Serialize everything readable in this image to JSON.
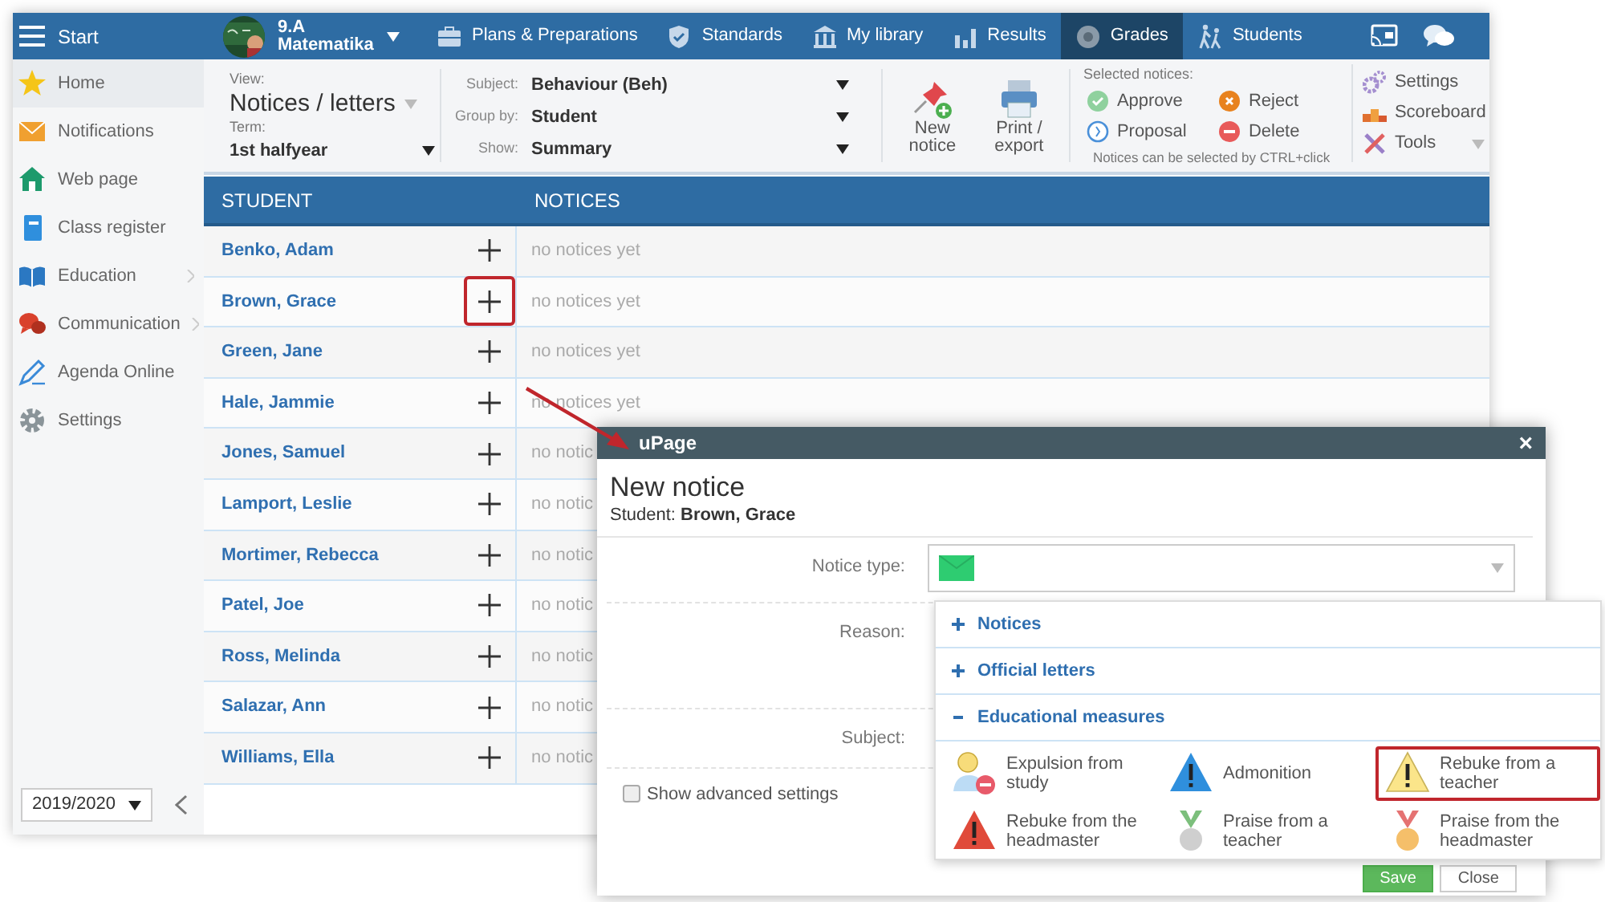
{
  "topbar": {
    "menu_label": "Start",
    "class_name": "9.A",
    "class_subject": "Matematika",
    "nav": [
      {
        "label": "Plans & Preparations",
        "selected": false
      },
      {
        "label": "Standards",
        "selected": false
      },
      {
        "label": "My library",
        "selected": false
      },
      {
        "label": "Results",
        "selected": false
      },
      {
        "label": "Grades",
        "selected": true
      },
      {
        "label": "Students",
        "selected": false
      }
    ]
  },
  "sidebar": {
    "items": [
      {
        "label": "Home",
        "selected": true,
        "has_submenu": false
      },
      {
        "label": "Notifications",
        "selected": false,
        "has_submenu": false
      },
      {
        "label": "Web page",
        "selected": false,
        "has_submenu": false
      },
      {
        "label": "Class register",
        "selected": false,
        "has_submenu": false
      },
      {
        "label": "Education",
        "selected": false,
        "has_submenu": true
      },
      {
        "label": "Communication",
        "selected": false,
        "has_submenu": true
      },
      {
        "label": "Agenda Online",
        "selected": false,
        "has_submenu": false
      },
      {
        "label": "Settings",
        "selected": false,
        "has_submenu": false
      }
    ],
    "year": "2019/2020"
  },
  "toolbar": {
    "view": {
      "label": "View:",
      "value": "Notices / letters"
    },
    "term": {
      "label": "Term:",
      "value": "1st halfyear"
    },
    "filters": [
      {
        "label": "Subject:",
        "value": "Behaviour (Beh)"
      },
      {
        "label": "Group by:",
        "value": "Student"
      },
      {
        "label": "Show:",
        "value": "Summary"
      }
    ],
    "actions": [
      "New notice",
      "Print / export"
    ],
    "selected_notices": {
      "title": "Selected notices:",
      "buttons": [
        "Approve",
        "Reject",
        "Proposal",
        "Delete"
      ],
      "hint": "Notices can be selected by CTRL+click"
    },
    "tools": [
      "Settings",
      "Scoreboard",
      "Tools"
    ]
  },
  "table": {
    "columns": [
      "STUDENT",
      "NOTICES"
    ],
    "rows": [
      {
        "student": "Benko, Adam",
        "notices": "no notices yet",
        "highlighted": false
      },
      {
        "student": "Brown, Grace",
        "notices": "no notices yet",
        "highlighted": true
      },
      {
        "student": "Green, Jane",
        "notices": "no notices yet",
        "highlighted": false
      },
      {
        "student": "Hale, Jammie",
        "notices": "no notices yet",
        "highlighted": false
      },
      {
        "student": "Jones, Samuel",
        "notices": "no notic",
        "highlighted": false
      },
      {
        "student": "Lamport, Leslie",
        "notices": "no notic",
        "highlighted": false
      },
      {
        "student": "Mortimer, Rebecca",
        "notices": "no notic",
        "highlighted": false
      },
      {
        "student": "Patel, Joe",
        "notices": "no notic",
        "highlighted": false
      },
      {
        "student": "Ross, Melinda",
        "notices": "no notic",
        "highlighted": false
      },
      {
        "student": "Salazar, Ann",
        "notices": "no notic",
        "highlighted": false
      },
      {
        "student": "Williams, Ella",
        "notices": "no notic",
        "highlighted": false
      }
    ]
  },
  "dialog": {
    "title": "uPage",
    "close": "×",
    "heading": "New notice",
    "subtitle": "Student: **Brown, Grace**",
    "fields": [
      {
        "label": "Notice type:"
      },
      {
        "label": "Reason:"
      },
      {
        "label": "Subject:"
      }
    ],
    "advanced": {
      "label": "Show advanced settings",
      "checked": false
    },
    "buttons": [
      "Save",
      "Close"
    ]
  },
  "notice_type_dropdown": {
    "groups": [
      {
        "label": "Notices",
        "expanded": false
      },
      {
        "label": "Official letters",
        "expanded": false
      },
      {
        "label": "Educational measures",
        "expanded": true,
        "options": [
          {
            "label": "Expulsion from study",
            "selected": false
          },
          {
            "label": "Admonition",
            "selected": false
          },
          {
            "label": "Rebuke from a teacher",
            "selected": true
          },
          {
            "label": "Rebuke from the headmaster",
            "selected": false
          },
          {
            "label": "Praise from a teacher",
            "selected": false
          },
          {
            "label": "Praise from the headmaster",
            "selected": false
          }
        ]
      }
    ]
  }
}
